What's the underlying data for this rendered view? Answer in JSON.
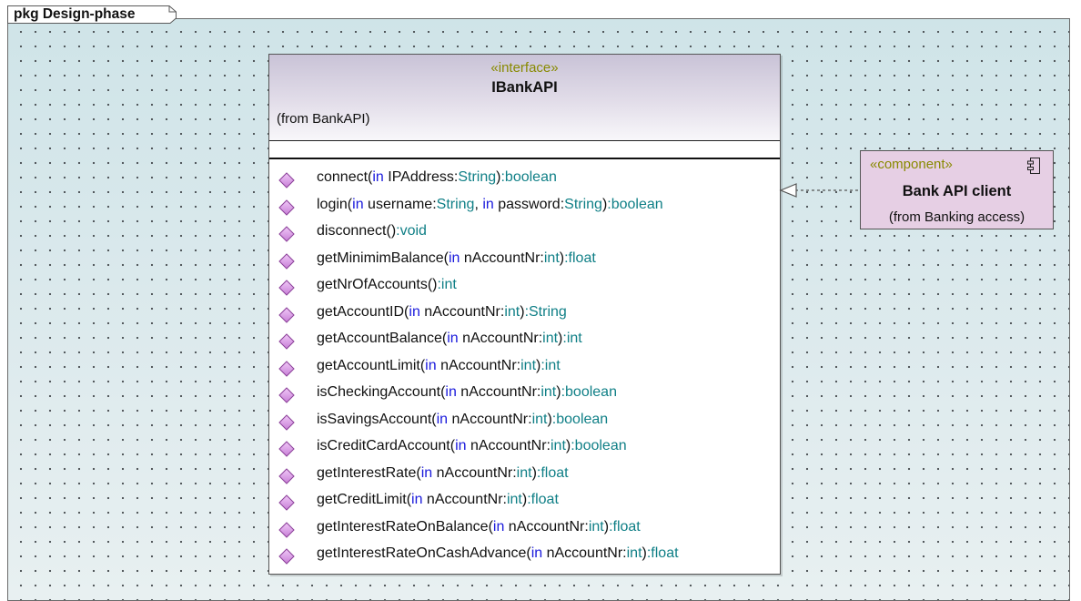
{
  "package": {
    "label": "pkg Design-phase"
  },
  "interface": {
    "stereotype": "«interface»",
    "name": "IBankAPI",
    "from": "(from BankAPI)",
    "operations": [
      {
        "name": "connect(",
        "parts": [
          [
            "kw",
            "in"
          ],
          [
            "tx",
            " IPAddress:"
          ],
          [
            "tp",
            "String"
          ],
          [
            "tx",
            ")"
          ],
          [
            "tp",
            ":boolean"
          ]
        ]
      },
      {
        "name": "login(",
        "parts": [
          [
            "kw",
            "in"
          ],
          [
            "tx",
            " username:"
          ],
          [
            "tp",
            "String"
          ],
          [
            "tx",
            ", "
          ],
          [
            "kw",
            "in"
          ],
          [
            "tx",
            " password:"
          ],
          [
            "tp",
            "String"
          ],
          [
            "tx",
            ")"
          ],
          [
            "tp",
            ":boolean"
          ]
        ]
      },
      {
        "name": "disconnect()",
        "parts": [
          [
            "tp",
            ":void"
          ]
        ]
      },
      {
        "name": "getMinimimBalance(",
        "parts": [
          [
            "kw",
            "in"
          ],
          [
            "tx",
            " nAccountNr:"
          ],
          [
            "tp",
            "int"
          ],
          [
            "tx",
            ")"
          ],
          [
            "tp",
            ":float"
          ]
        ]
      },
      {
        "name": "getNrOfAccounts()",
        "parts": [
          [
            "tp",
            ":int"
          ]
        ]
      },
      {
        "name": "getAccountID(",
        "parts": [
          [
            "kw",
            "in"
          ],
          [
            "tx",
            " nAccountNr:"
          ],
          [
            "tp",
            "int"
          ],
          [
            "tx",
            ")"
          ],
          [
            "tp",
            ":String"
          ]
        ]
      },
      {
        "name": "getAccountBalance(",
        "parts": [
          [
            "kw",
            "in"
          ],
          [
            "tx",
            " nAccountNr:"
          ],
          [
            "tp",
            "int"
          ],
          [
            "tx",
            ")"
          ],
          [
            "tp",
            ":int"
          ]
        ]
      },
      {
        "name": "getAccountLimit(",
        "parts": [
          [
            "kw",
            "in"
          ],
          [
            "tx",
            " nAccountNr:"
          ],
          [
            "tp",
            "int"
          ],
          [
            "tx",
            ")"
          ],
          [
            "tp",
            ":int"
          ]
        ]
      },
      {
        "name": "isCheckingAccount(",
        "parts": [
          [
            "kw",
            "in"
          ],
          [
            "tx",
            " nAccountNr:"
          ],
          [
            "tp",
            "int"
          ],
          [
            "tx",
            ")"
          ],
          [
            "tp",
            ":boolean"
          ]
        ]
      },
      {
        "name": "isSavingsAccount(",
        "parts": [
          [
            "kw",
            "in"
          ],
          [
            "tx",
            " nAccountNr:"
          ],
          [
            "tp",
            "int"
          ],
          [
            "tx",
            ")"
          ],
          [
            "tp",
            ":boolean"
          ]
        ]
      },
      {
        "name": "isCreditCardAccount(",
        "parts": [
          [
            "kw",
            "in"
          ],
          [
            "tx",
            " nAccountNr:"
          ],
          [
            "tp",
            "int"
          ],
          [
            "tx",
            ")"
          ],
          [
            "tp",
            ":boolean"
          ]
        ]
      },
      {
        "name": "getInterestRate(",
        "parts": [
          [
            "kw",
            "in"
          ],
          [
            "tx",
            " nAccountNr:"
          ],
          [
            "tp",
            "int"
          ],
          [
            "tx",
            ")"
          ],
          [
            "tp",
            ":float"
          ]
        ]
      },
      {
        "name": "getCreditLimit(",
        "parts": [
          [
            "kw",
            "in"
          ],
          [
            "tx",
            " nAccountNr:"
          ],
          [
            "tp",
            "int"
          ],
          [
            "tx",
            ")"
          ],
          [
            "tp",
            ":float"
          ]
        ]
      },
      {
        "name": "getInterestRateOnBalance(",
        "parts": [
          [
            "kw",
            "in"
          ],
          [
            "tx",
            " nAccountNr:"
          ],
          [
            "tp",
            "int"
          ],
          [
            "tx",
            ")"
          ],
          [
            "tp",
            ":float"
          ]
        ]
      },
      {
        "name": "getInterestRateOnCashAdvance(",
        "parts": [
          [
            "kw",
            "in"
          ],
          [
            "tx",
            " nAccountNr:"
          ],
          [
            "tp",
            "int"
          ],
          [
            "tx",
            ")"
          ],
          [
            "tp",
            ":float"
          ]
        ]
      }
    ]
  },
  "component": {
    "stereotype": "«component»",
    "name": "Bank API client",
    "from": "(from Banking access)"
  },
  "colors": {
    "keyword": "#1a1adc",
    "type": "#0f7f86",
    "stereotype": "#888a00",
    "operation_icon": "#c77fd6",
    "component_fill": "#e6cfe4"
  }
}
